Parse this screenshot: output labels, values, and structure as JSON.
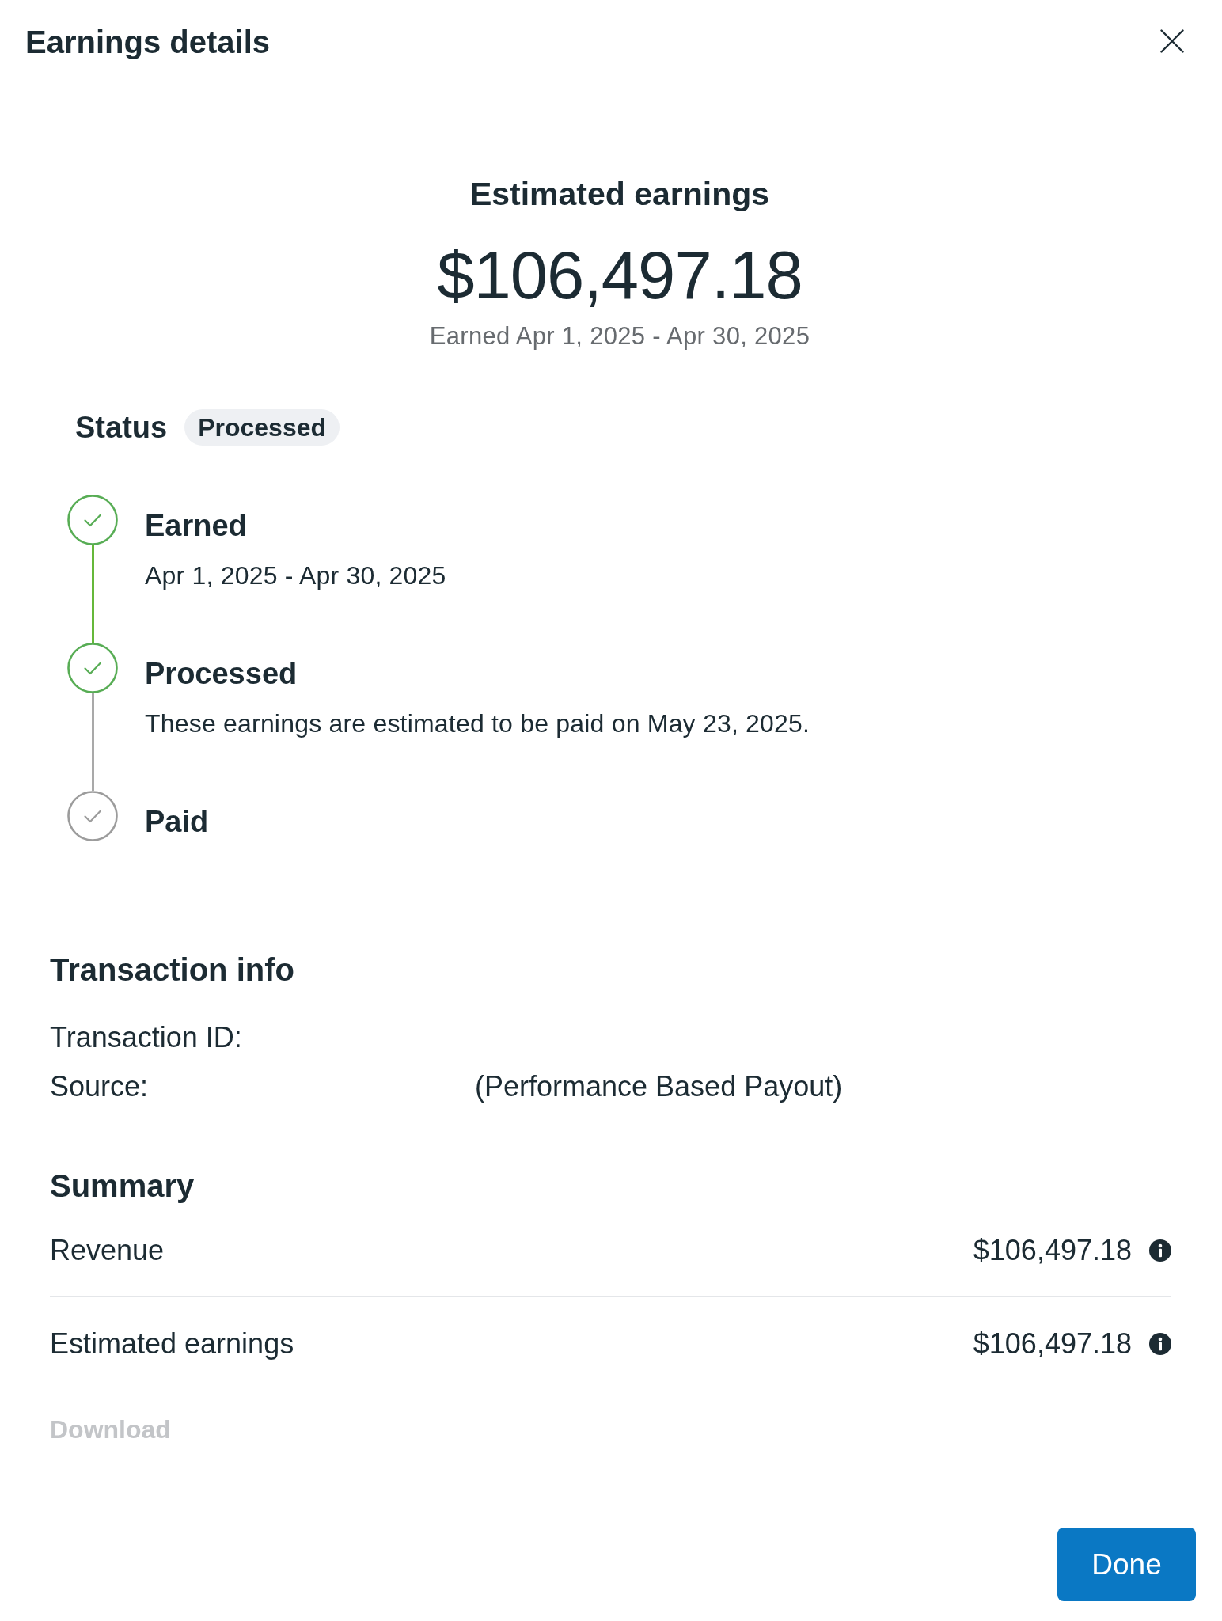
{
  "dialog": {
    "title": "Earnings details"
  },
  "estimate": {
    "label": "Estimated earnings",
    "amount": "$106,497.18",
    "period": "Earned Apr 1, 2025 - Apr 30, 2025"
  },
  "status": {
    "label": "Status",
    "badge": "Processed"
  },
  "timeline": [
    {
      "title": "Earned",
      "detail": "Apr 1, 2025 - Apr 30, 2025",
      "done": true
    },
    {
      "title": "Processed",
      "detail": "These earnings are estimated to be paid on May 23, 2025.",
      "done": true
    },
    {
      "title": "Paid",
      "done": false
    }
  ],
  "transaction_info": {
    "title": "Transaction info",
    "rows": [
      {
        "label": "Transaction ID:"
      },
      {
        "label": "Source:",
        "value": "(Performance Based Payout)"
      }
    ]
  },
  "summary": {
    "title": "Summary",
    "rows": [
      {
        "label": "Revenue",
        "value": "$106,497.18"
      },
      {
        "label": "Estimated earnings",
        "value": "$106,497.18"
      }
    ]
  },
  "download": {
    "label": "Download",
    "disabled": true
  },
  "done_button": {
    "label": "Done"
  }
}
